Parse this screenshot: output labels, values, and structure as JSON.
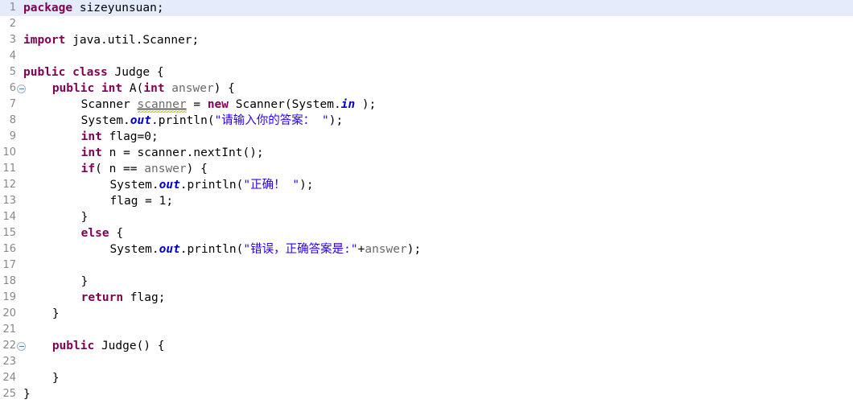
{
  "editor": {
    "language": "java",
    "total_lines": 25,
    "current_line": 1,
    "colors": {
      "keyword": "#7f0055",
      "string": "#2a00ff",
      "static_field": "#0000c0",
      "parameter": "#6a6a6a",
      "plain": "#000000",
      "line_number": "#888888",
      "current_line_highlight": "#e4ecfb",
      "background": "#ffffff",
      "warning_squiggle": "#d6b000"
    },
    "lines": [
      {
        "number": "1",
        "highlighted": true,
        "fold": false,
        "indent": 0,
        "tokens": [
          {
            "t": "package",
            "c": "kw"
          },
          {
            "t": " sizeyunsuan;",
            "c": "pln"
          }
        ]
      },
      {
        "number": "2",
        "highlighted": false,
        "fold": false,
        "indent": 0,
        "tokens": []
      },
      {
        "number": "3",
        "highlighted": false,
        "fold": false,
        "indent": 0,
        "tokens": [
          {
            "t": "import",
            "c": "kw"
          },
          {
            "t": " java.util.Scanner;",
            "c": "pln"
          }
        ]
      },
      {
        "number": "4",
        "highlighted": false,
        "fold": false,
        "indent": 0,
        "tokens": []
      },
      {
        "number": "5",
        "highlighted": false,
        "fold": false,
        "indent": 0,
        "tokens": [
          {
            "t": "public",
            "c": "kw"
          },
          {
            "t": " ",
            "c": "pln"
          },
          {
            "t": "class",
            "c": "kw"
          },
          {
            "t": " Judge {",
            "c": "pln"
          }
        ]
      },
      {
        "number": "6",
        "highlighted": false,
        "fold": true,
        "indent": 4,
        "tokens": [
          {
            "t": "public",
            "c": "kw"
          },
          {
            "t": " ",
            "c": "pln"
          },
          {
            "t": "int",
            "c": "kw"
          },
          {
            "t": " A(",
            "c": "pln"
          },
          {
            "t": "int",
            "c": "kw"
          },
          {
            "t": " ",
            "c": "pln"
          },
          {
            "t": "answer",
            "c": "par"
          },
          {
            "t": ") {",
            "c": "pln"
          }
        ]
      },
      {
        "number": "7",
        "highlighted": false,
        "fold": false,
        "indent": 8,
        "tokens": [
          {
            "t": "Scanner ",
            "c": "pln"
          },
          {
            "t": "scanner",
            "c": "warn"
          },
          {
            "t": " = ",
            "c": "pln"
          },
          {
            "t": "new",
            "c": "kw"
          },
          {
            "t": " Scanner(System.",
            "c": "pln"
          },
          {
            "t": "in",
            "c": "fld"
          },
          {
            "t": " );",
            "c": "pln"
          }
        ]
      },
      {
        "number": "8",
        "highlighted": false,
        "fold": false,
        "indent": 8,
        "tokens": [
          {
            "t": "System.",
            "c": "pln"
          },
          {
            "t": "out",
            "c": "fld"
          },
          {
            "t": ".println(",
            "c": "pln"
          },
          {
            "t": "\"请输入你的答案： \"",
            "c": "str"
          },
          {
            "t": ");",
            "c": "pln"
          }
        ]
      },
      {
        "number": "9",
        "highlighted": false,
        "fold": false,
        "indent": 8,
        "tokens": [
          {
            "t": "int",
            "c": "kw"
          },
          {
            "t": " flag=",
            "c": "pln"
          },
          {
            "t": "0",
            "c": "num"
          },
          {
            "t": ";",
            "c": "pln"
          }
        ]
      },
      {
        "number": "10",
        "highlighted": false,
        "fold": false,
        "indent": 8,
        "tokens": [
          {
            "t": "int",
            "c": "kw"
          },
          {
            "t": " n = scanner.nextInt();",
            "c": "pln"
          }
        ]
      },
      {
        "number": "11",
        "highlighted": false,
        "fold": false,
        "indent": 8,
        "tokens": [
          {
            "t": "if",
            "c": "kw"
          },
          {
            "t": "( n == ",
            "c": "pln"
          },
          {
            "t": "answer",
            "c": "par"
          },
          {
            "t": ") {",
            "c": "pln"
          }
        ]
      },
      {
        "number": "12",
        "highlighted": false,
        "fold": false,
        "indent": 12,
        "tokens": [
          {
            "t": "System.",
            "c": "pln"
          },
          {
            "t": "out",
            "c": "fld"
          },
          {
            "t": ".println(",
            "c": "pln"
          },
          {
            "t": "\"正确！ \"",
            "c": "str"
          },
          {
            "t": ");",
            "c": "pln"
          }
        ]
      },
      {
        "number": "13",
        "highlighted": false,
        "fold": false,
        "indent": 12,
        "tokens": [
          {
            "t": "flag = ",
            "c": "pln"
          },
          {
            "t": "1",
            "c": "num"
          },
          {
            "t": ";",
            "c": "pln"
          }
        ]
      },
      {
        "number": "14",
        "highlighted": false,
        "fold": false,
        "indent": 8,
        "tokens": [
          {
            "t": "}",
            "c": "pln"
          }
        ]
      },
      {
        "number": "15",
        "highlighted": false,
        "fold": false,
        "indent": 8,
        "tokens": [
          {
            "t": "else",
            "c": "kw"
          },
          {
            "t": " {",
            "c": "pln"
          }
        ]
      },
      {
        "number": "16",
        "highlighted": false,
        "fold": false,
        "indent": 12,
        "tokens": [
          {
            "t": "System.",
            "c": "pln"
          },
          {
            "t": "out",
            "c": "fld"
          },
          {
            "t": ".println(",
            "c": "pln"
          },
          {
            "t": "\"错误，正确答案是:\"",
            "c": "str"
          },
          {
            "t": "+",
            "c": "pln"
          },
          {
            "t": "answer",
            "c": "par"
          },
          {
            "t": ");",
            "c": "pln"
          }
        ]
      },
      {
        "number": "17",
        "highlighted": false,
        "fold": false,
        "indent": 0,
        "tokens": []
      },
      {
        "number": "18",
        "highlighted": false,
        "fold": false,
        "indent": 8,
        "tokens": [
          {
            "t": "}",
            "c": "pln"
          }
        ]
      },
      {
        "number": "19",
        "highlighted": false,
        "fold": false,
        "indent": 8,
        "tokens": [
          {
            "t": "return",
            "c": "kw"
          },
          {
            "t": " flag;",
            "c": "pln"
          }
        ]
      },
      {
        "number": "20",
        "highlighted": false,
        "fold": false,
        "indent": 4,
        "tokens": [
          {
            "t": "}",
            "c": "pln"
          }
        ]
      },
      {
        "number": "21",
        "highlighted": false,
        "fold": false,
        "indent": 0,
        "tokens": []
      },
      {
        "number": "22",
        "highlighted": false,
        "fold": true,
        "indent": 4,
        "tokens": [
          {
            "t": "public",
            "c": "kw"
          },
          {
            "t": " Judge() {",
            "c": "pln"
          }
        ]
      },
      {
        "number": "23",
        "highlighted": false,
        "fold": false,
        "indent": 0,
        "tokens": []
      },
      {
        "number": "24",
        "highlighted": false,
        "fold": false,
        "indent": 4,
        "tokens": [
          {
            "t": "}",
            "c": "pln"
          }
        ]
      },
      {
        "number": "25",
        "highlighted": false,
        "fold": false,
        "indent": 0,
        "tokens": [
          {
            "t": "}",
            "c": "pln"
          }
        ]
      }
    ]
  }
}
